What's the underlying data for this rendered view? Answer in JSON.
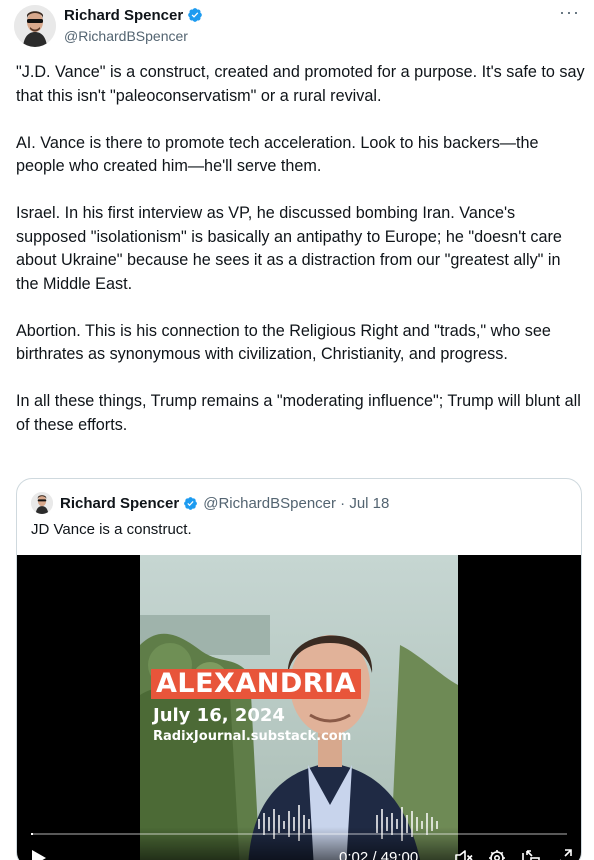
{
  "author": {
    "name": "Richard Spencer",
    "handle": "@RichardBSpencer",
    "more_label": "···"
  },
  "tweet": {
    "paragraphs": [
      "\"J.D. Vance\" is a construct, created and promoted for a purpose.  It's safe to say that this isn't \"paleoconservatism\" or a rural revival.",
      "AI. Vance is there to promote tech acceleration. Look to his backers—the people who created him—he'll serve them.",
      "Israel. In his first interview as VP, he discussed bombing Iran. Vance's supposed \"isolationism\" is basically an antipathy to Europe; he \"doesn't care about Ukraine\" because he sees it as a distraction from our \"greatest ally\" in the Middle East.",
      "Abortion. This is his connection to the Religious Right and \"trads,\" who see birthrates as synonymous with civilization, Christianity, and progress.",
      "In all these things, Trump remains a \"moderating influence\"; Trump will blunt all of these efforts."
    ]
  },
  "quote": {
    "name": "Richard Spencer",
    "handle": "@RichardBSpencer · Jul 18",
    "text": "JD Vance is a construct."
  },
  "video": {
    "title_overlay": "ALEXANDRIA",
    "date_overlay": "July 16, 2024",
    "site_overlay": "RadixJournal.substack.com",
    "time": "0:02 / 49:00",
    "progress": 0.0007
  },
  "colors": {
    "verified": "#1d9bf0",
    "title_bg": "#e8553a",
    "handle": "#536471"
  },
  "icons": {
    "verified": "verified-badge-icon",
    "more": "more-icon",
    "play": "play-icon",
    "mute": "volume-muted-icon",
    "settings": "settings-gear-icon",
    "pip": "picture-in-picture-icon",
    "fullscreen": "fullscreen-icon"
  }
}
